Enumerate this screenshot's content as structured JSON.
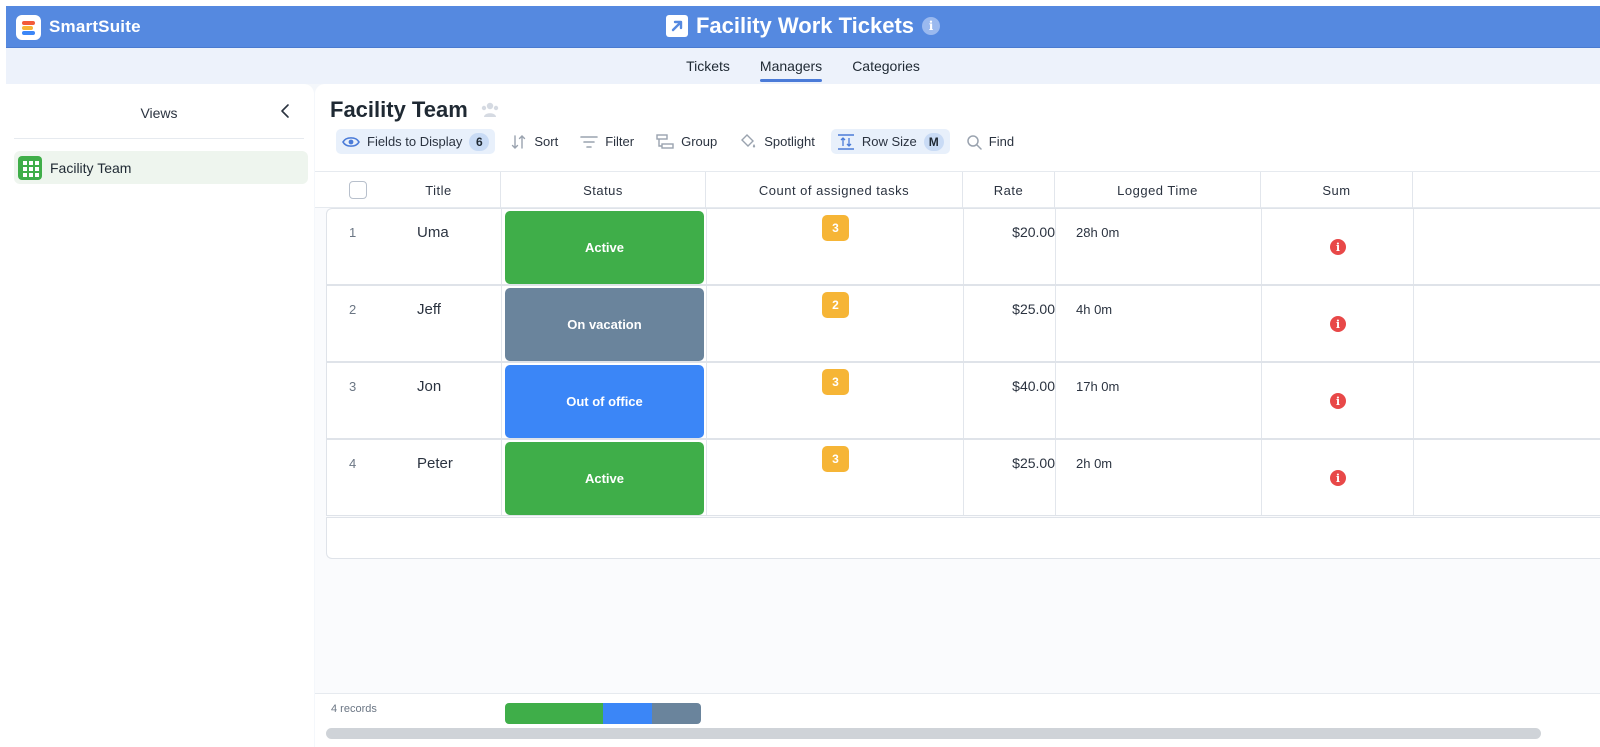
{
  "app": {
    "brand": "SmartSuite",
    "title": "Facility Work Tickets",
    "info_glyph": "i"
  },
  "nav_tabs": [
    {
      "label": "Tickets",
      "active": false
    },
    {
      "label": "Managers",
      "active": true
    },
    {
      "label": "Categories",
      "active": false
    }
  ],
  "sidebar": {
    "title": "Views",
    "items": [
      {
        "label": "Facility Team",
        "icon": "grid-view-icon",
        "active": true
      }
    ]
  },
  "main": {
    "title": "Facility Team",
    "toolbar": {
      "fields_label": "Fields to Display",
      "fields_count": "6",
      "sort_label": "Sort",
      "filter_label": "Filter",
      "group_label": "Group",
      "spotlight_label": "Spotlight",
      "rowsize_label": "Row Size",
      "rowsize_value": "M",
      "find_label": "Find"
    },
    "columns": [
      "Title",
      "Status",
      "Count of assigned tasks",
      "Rate",
      "Logged Time",
      "Sum"
    ],
    "rows": [
      {
        "num": "1",
        "title": "Uma",
        "status": "Active",
        "status_color": "#3fae49",
        "count": "3",
        "rate": "$20.00",
        "logged": "28h 0m"
      },
      {
        "num": "2",
        "title": "Jeff",
        "status": "On vacation",
        "status_color": "#6a849c",
        "count": "2",
        "rate": "$25.00",
        "logged": "4h 0m"
      },
      {
        "num": "3",
        "title": "Jon",
        "status": "Out of office",
        "status_color": "#3b86f7",
        "count": "3",
        "rate": "$40.00",
        "logged": "17h 0m"
      },
      {
        "num": "4",
        "title": "Peter",
        "status": "Active",
        "status_color": "#3fae49",
        "count": "3",
        "rate": "$25.00",
        "logged": "2h 0m"
      }
    ],
    "footer": {
      "records": "4 records",
      "status_summary": [
        {
          "status": "Active",
          "count": 2,
          "color": "#3fae49"
        },
        {
          "status": "Out of office",
          "count": 1,
          "color": "#3b86f7"
        },
        {
          "status": "On vacation",
          "count": 1,
          "color": "#6a849c"
        }
      ]
    }
  },
  "colors": {
    "topbar": "#5589e0",
    "accent": "#4a7bd8",
    "count_badge": "#f6b536",
    "error_icon": "#e84848"
  }
}
